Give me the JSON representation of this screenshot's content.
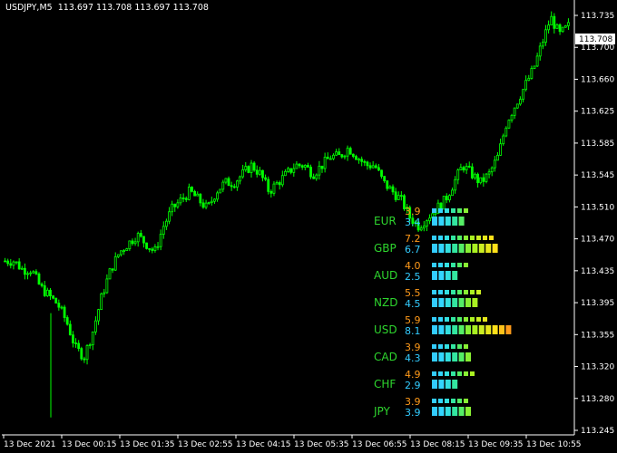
{
  "header": {
    "symbol": "USDJPY,M5",
    "ohlc": "113.697 113.708 113.697 113.708"
  },
  "price_axis": {
    "labels": [
      "113.735",
      "113.700",
      "113.660",
      "113.625",
      "113.585",
      "113.545",
      "113.510",
      "113.470",
      "113.435",
      "113.395",
      "113.355",
      "113.320",
      "113.280",
      "113.245"
    ],
    "current_price": "113.708"
  },
  "time_axis": {
    "labels": [
      "13 Dec 2021",
      "13 Dec 00:15",
      "13 Dec 01:35",
      "13 Dec 02:55",
      "13 Dec 04:15",
      "13 Dec 05:35",
      "13 Dec 06:55",
      "13 Dec 08:15",
      "13 Dec 09:35",
      "13 Dec 10:55"
    ]
  },
  "colors": {
    "background": "#000000",
    "candle": "#00ff00",
    "axis": "#ffffff",
    "label_top": "#ff9a1a",
    "label_bottom": "#33ccff",
    "currency_label": "#2ed62e"
  },
  "chart_data": {
    "type": "candlestick",
    "close_path": [
      113.44,
      113.44,
      113.43,
      113.43,
      113.41,
      113.4,
      113.39,
      113.37,
      113.34,
      113.33,
      113.36,
      113.4,
      113.43,
      113.45,
      113.46,
      113.47,
      113.46,
      113.45,
      113.48,
      113.5,
      113.51,
      113.52,
      113.51,
      113.5,
      113.52,
      113.53,
      113.53,
      113.54,
      113.55,
      113.54,
      113.52,
      113.53,
      113.54,
      113.55,
      113.55,
      113.54,
      113.55,
      113.56,
      113.56,
      113.57,
      113.56,
      113.55,
      113.55,
      113.53,
      113.52,
      113.51,
      113.49,
      113.48,
      113.49,
      113.5,
      113.51,
      113.53,
      113.55,
      113.54,
      113.53,
      113.54,
      113.56,
      113.6,
      113.62,
      113.64,
      113.66,
      113.69,
      113.72,
      113.7,
      113.71
    ],
    "indicator": [
      {
        "currency": "EUR",
        "top": "3.9",
        "bottom": "3.4"
      },
      {
        "currency": "GBP",
        "top": "7.2",
        "bottom": "6.7"
      },
      {
        "currency": "AUD",
        "top": "4.0",
        "bottom": "2.5"
      },
      {
        "currency": "NZD",
        "top": "5.5",
        "bottom": "4.5"
      },
      {
        "currency": "USD",
        "top": "5.9",
        "bottom": "8.1"
      },
      {
        "currency": "CAD",
        "top": "3.9",
        "bottom": "4.3"
      },
      {
        "currency": "CHF",
        "top": "4.9",
        "bottom": "2.9"
      },
      {
        "currency": "JPY",
        "top": "3.9",
        "bottom": "3.9"
      }
    ],
    "ylim": [
      113.24,
      113.74
    ]
  }
}
